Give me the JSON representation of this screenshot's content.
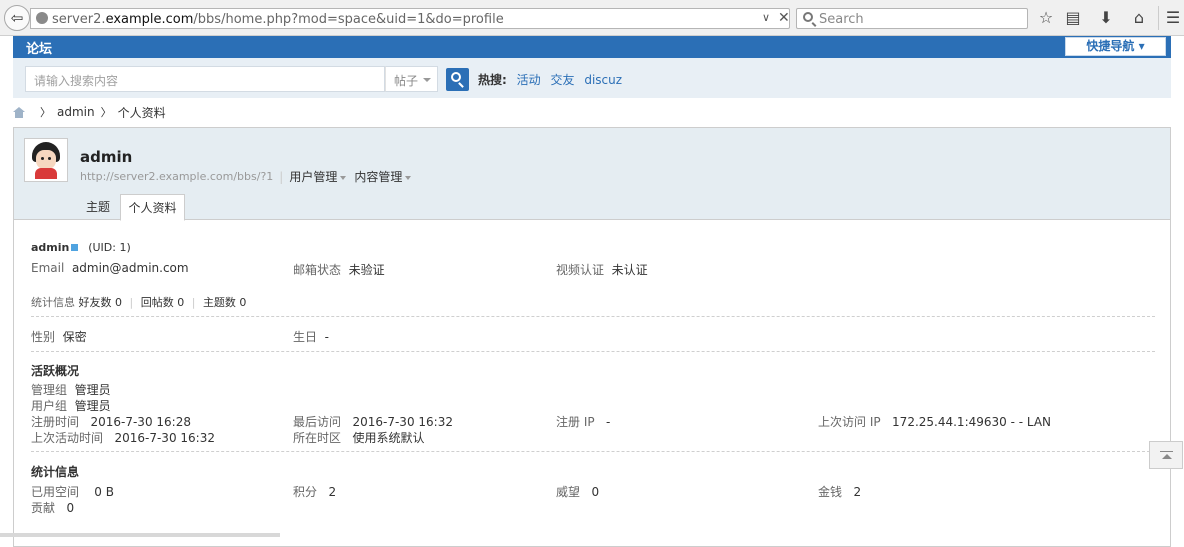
{
  "browser": {
    "url_prefix": "server2.",
    "url_domain": "example.com",
    "url_path": "/bbs/home.php?mod=space&uid=1&do=profile",
    "search_placeholder": "Search"
  },
  "topnav": {
    "forum": "论坛",
    "quick_nav": "快捷导航 ▾"
  },
  "search": {
    "placeholder": "请输入搜索内容",
    "type": "帖子",
    "hot_label": "热搜:",
    "hot_items": [
      "活动",
      "交友",
      "discuz"
    ]
  },
  "breadcrumb": {
    "user": "admin",
    "page": "个人资料"
  },
  "profile_header": {
    "username": "admin",
    "space_url": "http://server2.example.com/bbs/?1",
    "user_manage": "用户管理",
    "content_manage": "内容管理",
    "tabs": [
      "主题",
      "个人资料"
    ]
  },
  "profile": {
    "name": "admin",
    "uid": "(UID: 1)",
    "email_label": "Email",
    "email": "admin@admin.com",
    "email_status_label": "邮箱状态",
    "email_status": "未验证",
    "video_label": "视频认证",
    "video_status": "未认证",
    "stats_label": "统计信息",
    "friends": "好友数 0",
    "replies": "回帖数 0",
    "threads": "主题数 0",
    "gender_label": "性别",
    "gender": "保密",
    "birthday_label": "生日",
    "birthday": "-",
    "activity_title": "活跃概况",
    "admin_group_label": "管理组",
    "admin_group": "管理员",
    "user_group_label": "用户组",
    "user_group": "管理员",
    "reg_time_label": "注册时间",
    "reg_time": "2016-7-30 16:28",
    "last_visit_label": "最后访问",
    "last_visit": "2016-7-30 16:32",
    "reg_ip_label": "注册 IP",
    "reg_ip": "-",
    "last_ip_label": "上次访问 IP",
    "last_ip": "172.25.44.1:49630 - - LAN",
    "last_active_label": "上次活动时间",
    "last_active": "2016-7-30 16:32",
    "timezone_label": "所在时区",
    "timezone": "使用系统默认",
    "stats_title": "统计信息",
    "space_label": "已用空间",
    "space": "0 B",
    "points_label": "积分",
    "points": "2",
    "prestige_label": "威望",
    "prestige": "0",
    "money_label": "金钱",
    "money": "2",
    "contrib_label": "贡献",
    "contrib": "0"
  }
}
